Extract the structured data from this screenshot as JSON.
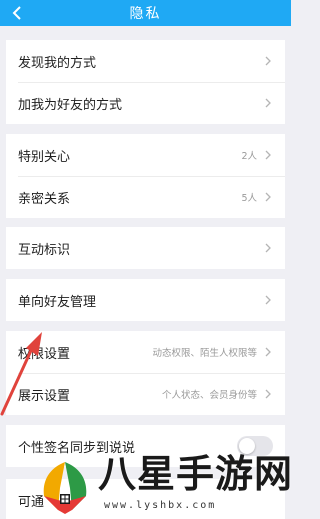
{
  "header": {
    "title": "隐私"
  },
  "groups": [
    {
      "items": [
        {
          "label": "发现我的方式",
          "value": ""
        },
        {
          "label": "加我为好友的方式",
          "value": ""
        }
      ]
    },
    {
      "items": [
        {
          "label": "特别关心",
          "value": "2人"
        },
        {
          "label": "亲密关系",
          "value": "5人"
        }
      ]
    },
    {
      "items": [
        {
          "label": "互动标识",
          "value": ""
        }
      ]
    },
    {
      "items": [
        {
          "label": "单向好友管理",
          "value": ""
        }
      ]
    },
    {
      "items": [
        {
          "label": "权限设置",
          "value": "动态权限、陌生人权限等"
        },
        {
          "label": "展示设置",
          "value": "个人状态、会员身份等"
        }
      ]
    },
    {
      "items": [
        {
          "label": "个性签名同步到说说",
          "toggle_on": false
        }
      ]
    },
    {
      "items": [
        {
          "label": "可通"
        }
      ]
    }
  ],
  "watermark": {
    "text": "八星手游网",
    "url": "www.lyshbx.com"
  },
  "colors": {
    "header": "#1fa9f4",
    "annotation_arrow": "#e0433c"
  }
}
